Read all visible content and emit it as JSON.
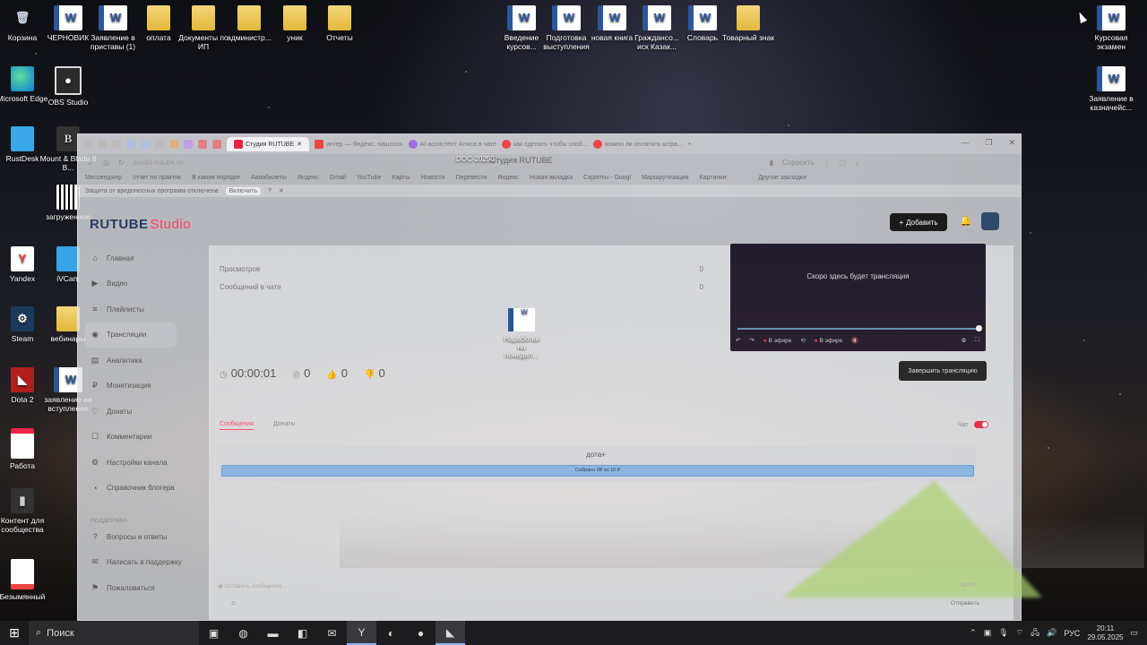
{
  "desktop_icons": {
    "recycle_bin": "Корзина",
    "chernovik": "ЧЕРНОВИК",
    "zayavlenie_pristavy": "Заявление в приставы (1)",
    "oplata": "оплата",
    "docs_ip": "Документы по ИП",
    "administr": "администр...",
    "unik": "уник",
    "otchety": "Отчеты",
    "vvedenie": "Введение курсов...",
    "podgotovka": "Подготовка выступления",
    "novaya_kniga": "новая книга",
    "grazhdansk": "Граждансо... иск Казак...",
    "slovar": "Словарь",
    "tovarny_znak": "Товарный знак",
    "kursovaya": "Курсовая экзамен",
    "zayavlenie_kazn": "Заявление в казначейс...",
    "edge": "Microsoft Edge",
    "obs": "OBS Studio",
    "rustdesk": "RustDesk",
    "mount_blade": "Mount & Blade II B...",
    "zagruzhennoe": "загруженное",
    "yandex": "Yandex",
    "icam": "iVCam",
    "steam": "Steam",
    "vebinary": "вебинары",
    "dota": "Dota 2",
    "zayavlenie_vstup": "заявление на вступление",
    "rabota": "Работа",
    "kontent": "Контент для сообщества",
    "bezymyanny": "Безымянный",
    "narabotki": "Наработки на понедел...",
    "doc_label": "DOC-20250"
  },
  "browser": {
    "tabs": [
      "Студия RUTUBE",
      "интер — Яндекс: нашлось",
      "AI-ассистент Алиса в чате",
      "как сделать чтобы сооб...",
      "можно ли оплатить штра..."
    ],
    "url": "studio.rutube.ru",
    "page_title": "Студия RUTUBE",
    "ask_label": "Спросить",
    "bookmarks": [
      "Мессенджер",
      "отчет по практик",
      "В каком порядке",
      "Авиабилеты",
      "Яндекс",
      "Gmail",
      "YouTube",
      "Карты",
      "Новости",
      "Перевести",
      "Яндекс",
      "Новая вкладка",
      "Скрипты - Googl",
      "Маршрутизация",
      "Картинки"
    ],
    "other_bookmarks": "Другие закладки",
    "notice_text": "Защита от вредоносных программ отключена",
    "notice_btn": "Включить"
  },
  "studio": {
    "logo_main": "RUTUBE",
    "logo_suffix": "Studio",
    "add_label": "Добавить",
    "nav": [
      "Главная",
      "Видео",
      "Плейлисты",
      "Трансляции",
      "Аналитика",
      "Монетизация",
      "Донаты",
      "Комментарии",
      "Настройки канала",
      "Справочник блогера"
    ],
    "support_heading": "ПОДДЕРЖКА",
    "support_nav": [
      "Вопросы и ответы",
      "Написать в поддержку",
      "Пожаловаться"
    ],
    "stats": [
      {
        "label": "Просмотров",
        "value": "0"
      },
      {
        "label": "Сообщений в чате",
        "value": "0"
      }
    ],
    "timer": "00:00:01",
    "views_count": "0",
    "likes_count": "0",
    "dislikes_count": "0",
    "player_text": "Скоро здесь будет трансляция",
    "player_live": "В эфире",
    "player_live2": "В эфире",
    "end_button": "Завершить трансляцию",
    "chat_tab_messages": "Сообщения",
    "chat_tab_donates": "Донаты",
    "chat_toggle": "Чат",
    "donate_title": "дота+",
    "donate_bar": "Собрано 0₽ из 10 ₽",
    "message_placeholder": "Оставить сообщение...",
    "message_counter": "0/200",
    "send_label": "Отправить"
  },
  "taskbar": {
    "search": "Поиск",
    "lang": "РУС",
    "time": "20:11",
    "date": "29.05.2025"
  }
}
